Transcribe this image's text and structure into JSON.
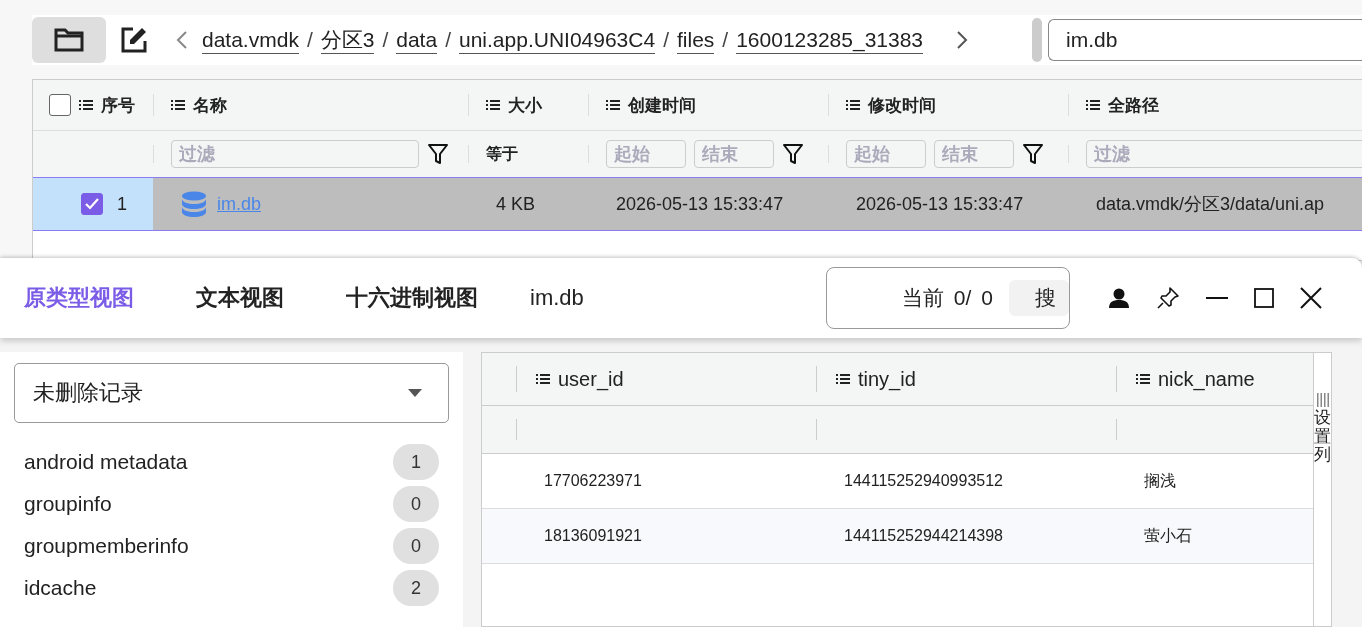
{
  "toolbar": {
    "breadcrumb": [
      "data.vmdk",
      "分区3",
      "data",
      "uni.app.UNI04963C4",
      "files",
      "1600123285_31383"
    ],
    "separator": "/",
    "search": {
      "value": "im.db"
    }
  },
  "file_table": {
    "select_all": {
      "checked": false
    },
    "columns": [
      "序号",
      "名称",
      "大小",
      "创建时间",
      "修改时间",
      "全路径"
    ],
    "filters": [
      {
        "kind": "none"
      },
      {
        "kind": "text",
        "placeholder": "过滤"
      },
      {
        "kind": "label",
        "text": "等于"
      },
      {
        "kind": "range",
        "from": {
          "placeholder": "起始"
        },
        "to": {
          "placeholder": "结束"
        }
      },
      {
        "kind": "range",
        "from": {
          "placeholder": "起始"
        },
        "to": {
          "placeholder": "结束"
        }
      },
      {
        "kind": "text",
        "placeholder": "过滤"
      }
    ],
    "rows": [
      {
        "selected": true,
        "checked": true,
        "number": "1",
        "name": "im.db",
        "size": "4 KB",
        "created": "2026-05-13 15:33:47",
        "modified": "2026-05-13 15:33:47",
        "path": "data.vmdk/分区3/data/uni.ap"
      }
    ]
  },
  "viewer": {
    "tabs": [
      {
        "label": "原类型视图",
        "selected": true
      },
      {
        "label": "文本视图",
        "selected": false
      },
      {
        "label": "十六进制视图",
        "selected": false
      }
    ],
    "file_name": "im.db",
    "search": {
      "label": "当前",
      "current": "0/",
      "total": "0",
      "button": "搜"
    },
    "record_filter": {
      "value": "未删除记录"
    },
    "tables": [
      {
        "name": "android metadata",
        "count": "1"
      },
      {
        "name": "groupinfo",
        "count": "0"
      },
      {
        "name": "groupmemberinfo",
        "count": "0"
      },
      {
        "name": "idcache",
        "count": "2"
      }
    ],
    "grid": {
      "columns": [
        "user_id",
        "tiny_id",
        "nick_name"
      ],
      "rows": [
        [
          "17706223971",
          "144115252940993512",
          "搁浅"
        ],
        [
          "18136091921",
          "144115252944214398",
          "萤小石"
        ]
      ],
      "settings_label": "设置列"
    }
  }
}
